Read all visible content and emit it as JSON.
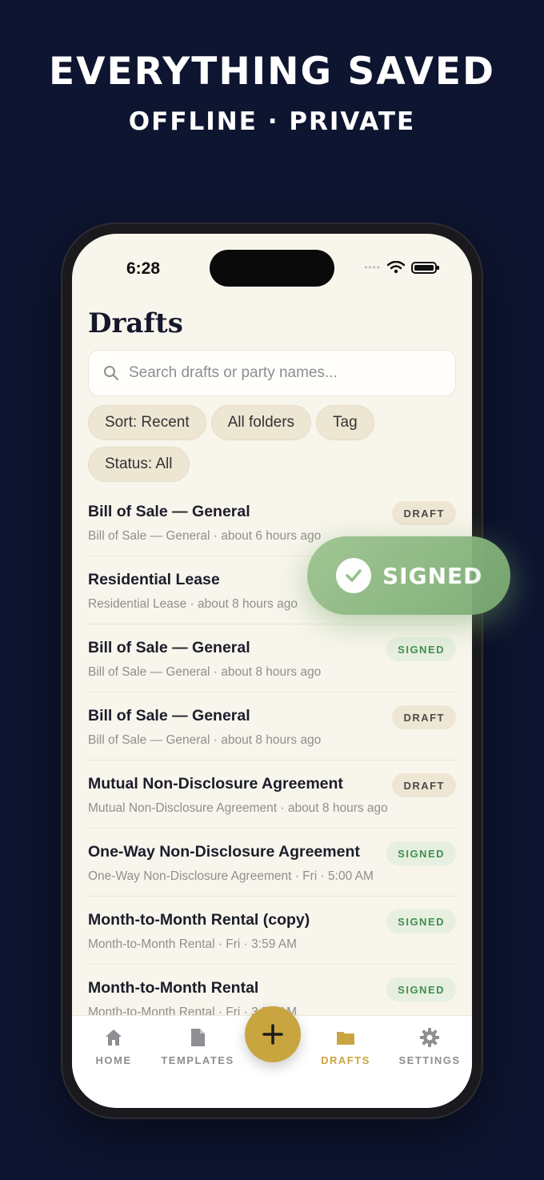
{
  "promo": {
    "headline": "EVERYTHING SAVED",
    "subheadline": "OFFLINE · PRIVATE"
  },
  "status_bar": {
    "time": "6:28"
  },
  "page": {
    "title": "Drafts"
  },
  "search": {
    "placeholder": "Search drafts or party names..."
  },
  "filters": [
    {
      "label": "Sort: Recent"
    },
    {
      "label": "All folders"
    },
    {
      "label": "Tag"
    },
    {
      "label": "Status: All"
    }
  ],
  "drafts": [
    {
      "title": "Bill of Sale — General",
      "subtitle": "Bill of Sale — General · about 6 hours ago",
      "status": "DRAFT"
    },
    {
      "title": "Residential Lease",
      "subtitle": "Residential Lease · about 8 hours ago",
      "status": ""
    },
    {
      "title": "Bill of Sale — General",
      "subtitle": "Bill of Sale — General · about 8 hours ago",
      "status": "SIGNED"
    },
    {
      "title": "Bill of Sale — General",
      "subtitle": "Bill of Sale — General · about 8 hours ago",
      "status": "DRAFT"
    },
    {
      "title": "Mutual Non-Disclosure Agreement",
      "subtitle": "Mutual Non-Disclosure Agreement · about 8 hours ago",
      "status": "DRAFT"
    },
    {
      "title": "One-Way Non-Disclosure Agreement",
      "subtitle": "One-Way Non-Disclosure Agreement · Fri · 5:00 AM",
      "status": "SIGNED"
    },
    {
      "title": "Month-to-Month Rental (copy)",
      "subtitle": "Month-to-Month Rental · Fri · 3:59 AM",
      "status": "SIGNED"
    },
    {
      "title": "Month-to-Month Rental",
      "subtitle": "Month-to-Month Rental · Fri · 3:59 AM",
      "status": "SIGNED"
    }
  ],
  "tabbar": {
    "home": "HOME",
    "templates": "TEMPLATES",
    "drafts": "DRAFTS",
    "settings": "SETTINGS",
    "active": "drafts"
  },
  "overlay": {
    "label": "SIGNED"
  },
  "colors": {
    "background": "#0e1530",
    "accent_gold": "#c9a53f",
    "signed_green": "#3f8f50",
    "screen_bg": "#f8f5ec"
  },
  "icons": {
    "search": "search-icon",
    "home": "home-icon",
    "templates": "document-icon",
    "drafts": "folder-icon",
    "settings": "gear-icon",
    "add": "plus-icon",
    "check": "check-icon"
  }
}
